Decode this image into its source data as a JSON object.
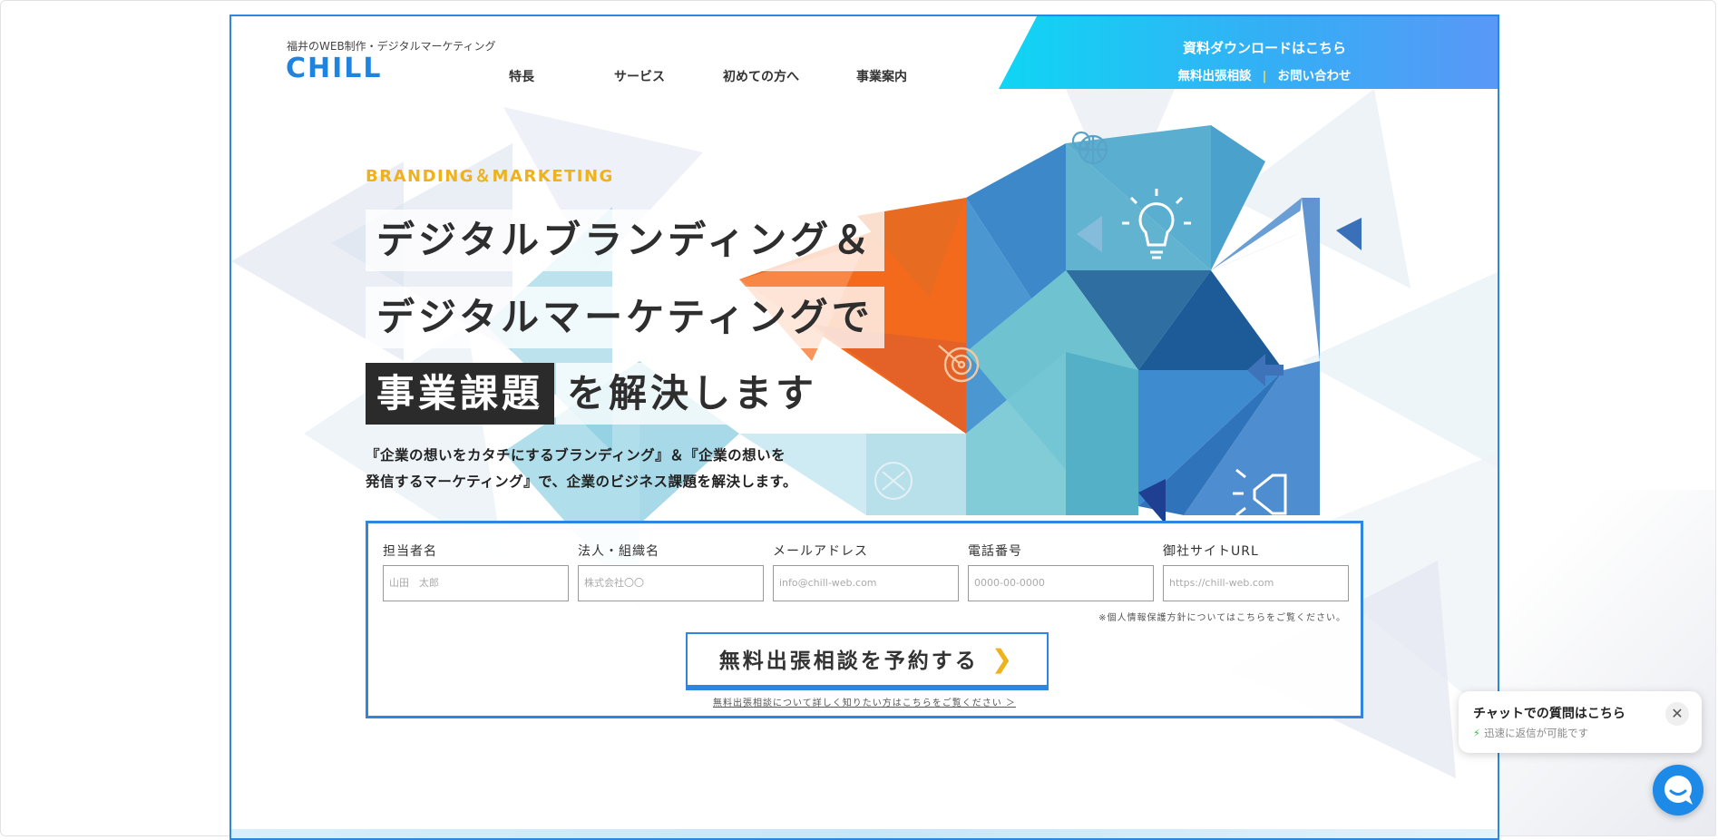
{
  "header": {
    "tagline": "福井のWEB制作・デジタルマーケティング",
    "logo": "CHILL",
    "nav": [
      "特長",
      "サービス",
      "初めての方へ",
      "事業案内"
    ],
    "cta_main": "資料ダウンロードはこちら",
    "cta_consult": "無料出張相談",
    "cta_divider": "|",
    "cta_contact": "お問い合わせ"
  },
  "hero": {
    "eyebrow": "BRANDING＆MARKETING",
    "headline_1": "デジタルブランディング＆",
    "headline_2": "デジタルマーケティングで",
    "headline_3a": "事業課題",
    "headline_3b": "を解決します",
    "desc_1": "『企業の想いをカタチにするブランディング』＆『企業の想いを",
    "desc_2": "発信するマーケティング』で、企業のビジネス課題を解決します。"
  },
  "form": {
    "fields": [
      {
        "label": "担当者名",
        "placeholder": "山田　太郎"
      },
      {
        "label": "法人・組織名",
        "placeholder": "株式会社〇〇"
      },
      {
        "label": "メールアドレス",
        "placeholder": "info@chill-web.com"
      },
      {
        "label": "電話番号",
        "placeholder": "0000-00-0000"
      },
      {
        "label": "御社サイトURL",
        "placeholder": "https://chill-web.com"
      }
    ],
    "privacy": "※個人情報保護方針についてはこちらをご覧ください。",
    "submit": "無料出張相談を予約する",
    "note": "無料出張相談について詳しく知りたい方はこちらをご覧ください ＞"
  },
  "chat": {
    "title": "チャットでの質問はこちら",
    "subtitle": "迅速に返信が可能です",
    "close": "✕"
  },
  "colors": {
    "brand_blue": "#1f83e0",
    "accent_yellow": "#efb21d",
    "orange": "#f36a1c"
  },
  "icons": [
    "location-globe-icon",
    "lightbulb-icon",
    "target-icon",
    "arrow-left-icon",
    "megaphone-icon",
    "chevron-right-icon",
    "bolt-icon",
    "chat-bubble-icon",
    "close-icon"
  ]
}
